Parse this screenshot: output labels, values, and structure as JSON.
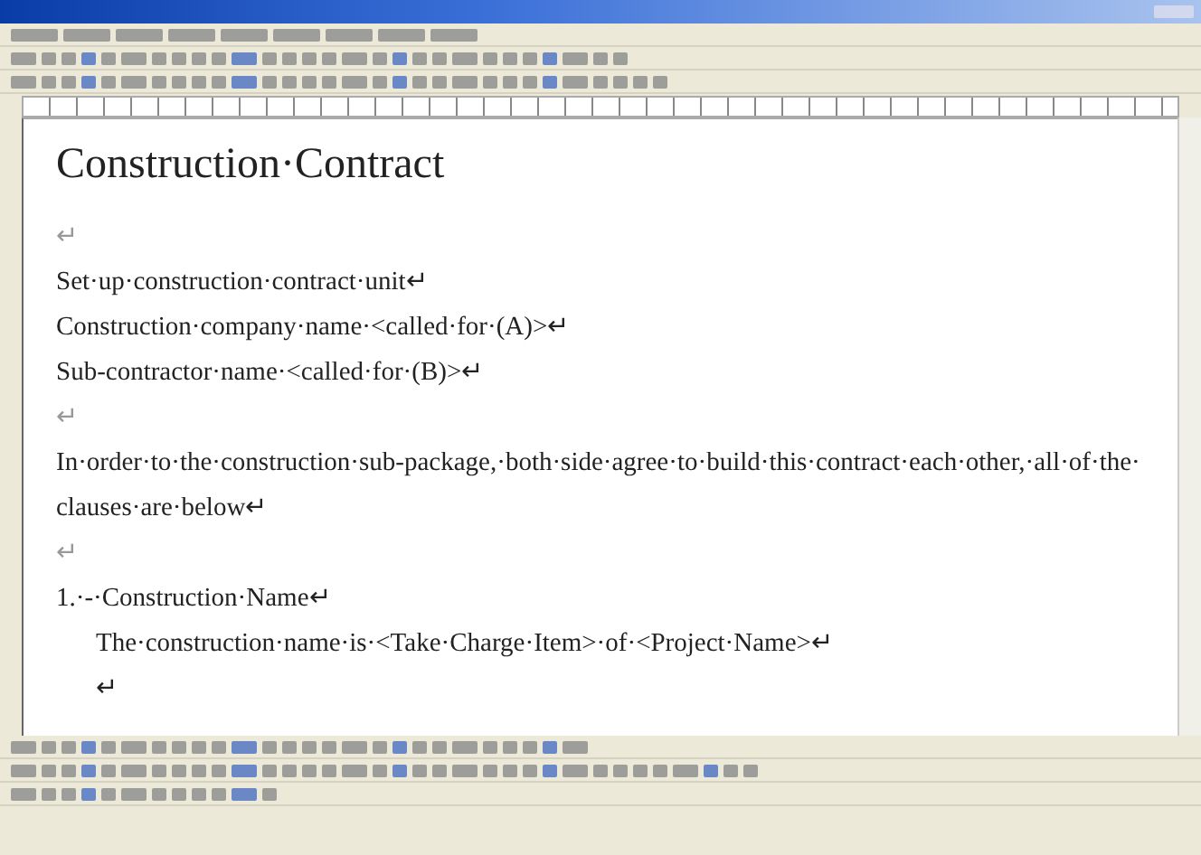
{
  "document": {
    "title": "Construction·Contract",
    "paragraphs": [
      {
        "kind": "mark",
        "text": "↵"
      },
      {
        "kind": "line",
        "text": "Set·up·construction·contract·unit↵"
      },
      {
        "kind": "line",
        "text": "Construction·company·name·<called·for·(A)>↵"
      },
      {
        "kind": "line",
        "text": "Sub-contractor·name·<called·for·(B)>↵"
      },
      {
        "kind": "mark",
        "text": "↵"
      },
      {
        "kind": "line",
        "text": "In·order·to·the·construction·sub-package,·both·side·agree·to·build·this·contract·each·other,·all·of·the·clauses·are·below↵"
      },
      {
        "kind": "mark",
        "text": "↵"
      },
      {
        "kind": "line",
        "text": "1.·-·Construction·Name↵"
      },
      {
        "kind": "indent",
        "text": "The·construction·name·is·<Take·Charge·Item>·of·<Project·Name>↵"
      },
      {
        "kind": "indent",
        "text": "↵"
      }
    ]
  }
}
